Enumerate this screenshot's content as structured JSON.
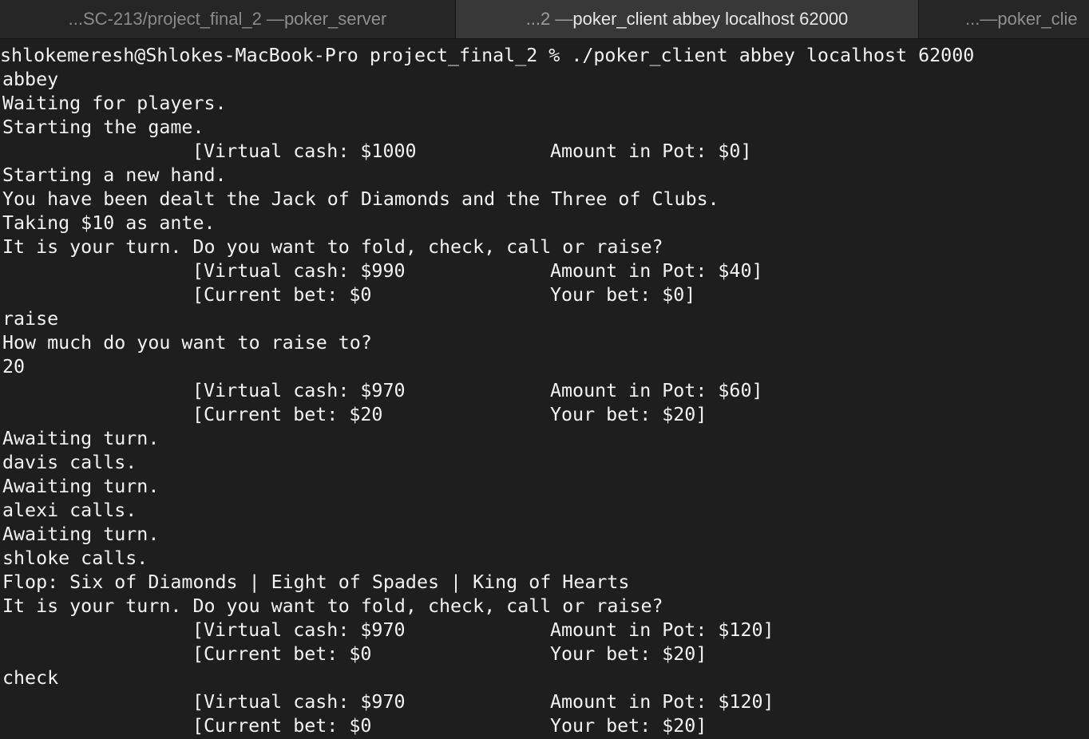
{
  "tabs": [
    {
      "prefix": "...SC-213/project_final_2 — ",
      "title": "poker_server"
    },
    {
      "prefix": "...2 — ",
      "title": "poker_client abbey localhost 62000"
    },
    {
      "prefix": "...— ",
      "title": "poker_clie"
    }
  ],
  "terminal": {
    "lines": [
      {
        "text": "shlokemeresh@Shlokes-MacBook-Pro project_final_2 % ./poker_client abbey localhost 62000"
      },
      {
        "text": "abbey"
      },
      {
        "text": "Waiting for players."
      },
      {
        "text": "Starting the game."
      },
      {
        "col1": "[Virtual cash: $1000",
        "col2": "Amount in Pot: $0]"
      },
      {
        "text": "Starting a new hand."
      },
      {
        "text": "You have been dealt the Jack of Diamonds and the Three of Clubs."
      },
      {
        "text": "Taking $10 as ante."
      },
      {
        "text": "It is your turn. Do you want to fold, check, call or raise?"
      },
      {
        "col1": "[Virtual cash: $990",
        "col2": "Amount in Pot: $40]"
      },
      {
        "col1": "[Current bet: $0",
        "col2": "Your bet: $0]"
      },
      {
        "text": "raise"
      },
      {
        "text": "How much do you want to raise to?"
      },
      {
        "text": "20"
      },
      {
        "col1": "[Virtual cash: $970",
        "col2": "Amount in Pot: $60]"
      },
      {
        "col1": "[Current bet: $20",
        "col2": "Your bet: $20]"
      },
      {
        "text": "Awaiting turn."
      },
      {
        "text": "davis calls."
      },
      {
        "text": "Awaiting turn."
      },
      {
        "text": "alexi calls."
      },
      {
        "text": "Awaiting turn."
      },
      {
        "text": "shloke calls."
      },
      {
        "text": "Flop: Six of Diamonds | Eight of Spades | King of Hearts"
      },
      {
        "text": "It is your turn. Do you want to fold, check, call or raise?"
      },
      {
        "col1": "[Virtual cash: $970",
        "col2": "Amount in Pot: $120]"
      },
      {
        "col1": "[Current bet: $0",
        "col2": "Your bet: $20]"
      },
      {
        "text": "check"
      },
      {
        "col1": "[Virtual cash: $970",
        "col2": "Amount in Pot: $120]"
      },
      {
        "col1": "[Current bet: $0",
        "col2": "Your bet: $20]"
      }
    ]
  }
}
